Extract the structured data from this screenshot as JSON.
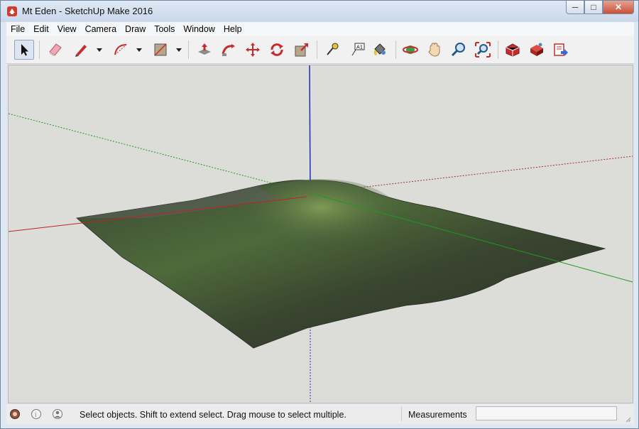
{
  "window": {
    "title": "Mt Eden - SketchUp Make 2016"
  },
  "window_buttons": {
    "minimize": "─",
    "maximize": "□",
    "close": "✕"
  },
  "menu": [
    {
      "label": "File",
      "name": "menu-file"
    },
    {
      "label": "Edit",
      "name": "menu-edit"
    },
    {
      "label": "View",
      "name": "menu-view"
    },
    {
      "label": "Camera",
      "name": "menu-camera"
    },
    {
      "label": "Draw",
      "name": "menu-draw"
    },
    {
      "label": "Tools",
      "name": "menu-tools"
    },
    {
      "label": "Window",
      "name": "menu-window"
    },
    {
      "label": "Help",
      "name": "menu-help"
    }
  ],
  "toolbar": {
    "tools": [
      "select-icon",
      "eraser-icon",
      "pencil-line-icon",
      "arc-icon",
      "rectangle-icon",
      "push-pull-icon",
      "follow-me-icon",
      "move-icon",
      "rotate-icon",
      "scale-icon",
      "tape-measure-icon",
      "text-icon",
      "paint-bucket-icon",
      "orbit-icon",
      "pan-icon",
      "zoom-icon",
      "zoom-extents-icon",
      "3d-warehouse-icon",
      "extension-warehouse-icon",
      "send-to-layout-icon"
    ]
  },
  "status": {
    "message": "Select objects. Shift to extend select. Drag mouse to select multiple.",
    "measurements_label": "Measurements",
    "measurements_value": ""
  },
  "colors": {
    "red_axis": "#c22222",
    "green_axis": "#1f9a1f",
    "blue_axis": "#1f2bb0",
    "sky": "#dcdcd8",
    "terrain_dark": "#2f3b2c"
  }
}
